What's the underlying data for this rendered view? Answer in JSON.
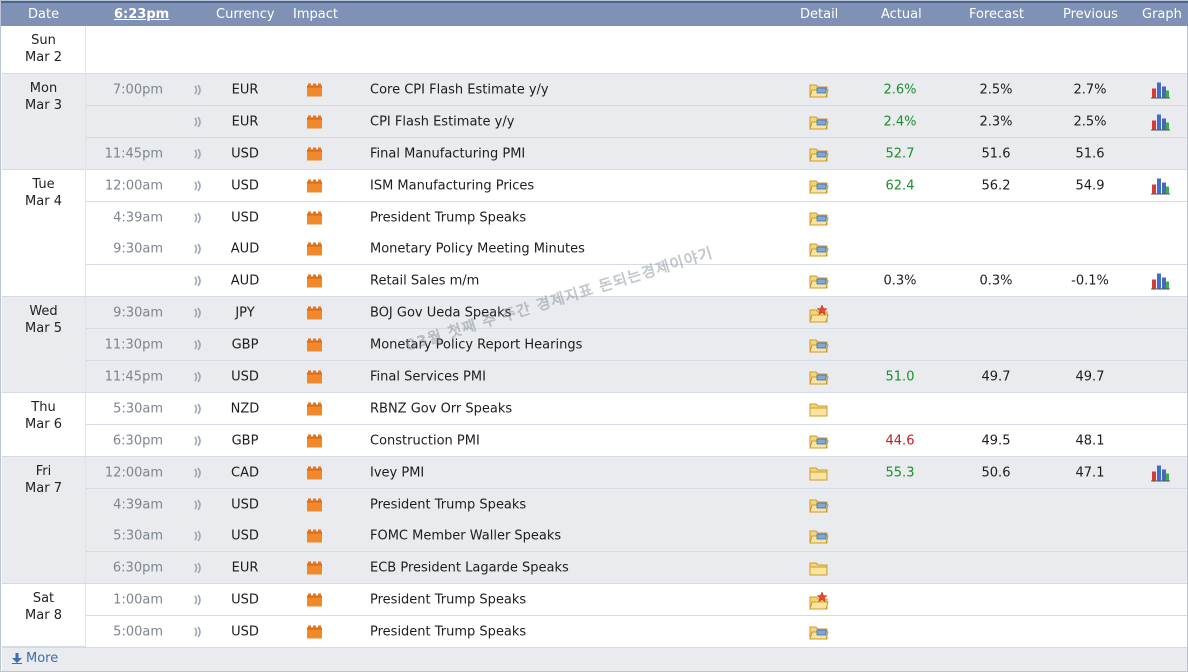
{
  "header": {
    "date": "Date",
    "time": "6:23pm",
    "currency": "Currency",
    "impact": "Impact",
    "detail": "Detail",
    "actual": "Actual",
    "forecast": "Forecast",
    "previous": "Previous",
    "graph": "Graph"
  },
  "days": [
    {
      "dow": "Sun",
      "date": "Mar 2"
    },
    {
      "dow": "Mon",
      "date": "Mar 3"
    },
    {
      "dow": "Tue",
      "date": "Mar 4"
    },
    {
      "dow": "Wed",
      "date": "Mar 5"
    },
    {
      "dow": "Thu",
      "date": "Mar 6"
    },
    {
      "dow": "Fri",
      "date": "Mar 7"
    },
    {
      "dow": "Sat",
      "date": "Mar 8"
    }
  ],
  "events": [
    {
      "time": "7:00pm",
      "currency": "EUR",
      "event": "Core CPI Flash Estimate y/y",
      "actual": "2.6%",
      "actual_status": "good",
      "forecast": "2.5%",
      "previous": "2.7%",
      "detail_icon": "folder-icon",
      "graph": true
    },
    {
      "time": "",
      "currency": "EUR",
      "event": "CPI Flash Estimate y/y",
      "actual": "2.4%",
      "actual_status": "good",
      "forecast": "2.3%",
      "previous": "2.5%",
      "detail_icon": "folder-icon",
      "graph": true
    },
    {
      "time": "11:45pm",
      "currency": "USD",
      "event": "Final Manufacturing PMI",
      "actual": "52.7",
      "actual_status": "good",
      "forecast": "51.6",
      "previous": "51.6",
      "detail_icon": "folder-icon",
      "graph": false
    },
    {
      "time": "12:00am",
      "currency": "USD",
      "event": "ISM Manufacturing Prices",
      "actual": "62.4",
      "actual_status": "good",
      "forecast": "56.2",
      "previous": "54.9",
      "detail_icon": "folder-icon",
      "graph": true
    },
    {
      "time": "4:39am",
      "currency": "USD",
      "event": "President Trump Speaks",
      "actual": "",
      "actual_status": "neutral",
      "forecast": "",
      "previous": "",
      "detail_icon": "folder-icon",
      "graph": false
    },
    {
      "time": "9:30am",
      "currency": "AUD",
      "event": "Monetary Policy Meeting Minutes",
      "actual": "",
      "actual_status": "neutral",
      "forecast": "",
      "previous": "",
      "detail_icon": "folder-icon",
      "graph": false
    },
    {
      "time": "",
      "currency": "AUD",
      "event": "Retail Sales m/m",
      "actual": "0.3%",
      "actual_status": "neutral",
      "forecast": "0.3%",
      "previous": "-0.1%",
      "detail_icon": "folder-icon",
      "graph": true
    },
    {
      "time": "9:30am",
      "currency": "JPY",
      "event": "BOJ Gov Ueda Speaks",
      "actual": "",
      "actual_status": "neutral",
      "forecast": "",
      "previous": "",
      "detail_icon": "folder-star-icon",
      "graph": false
    },
    {
      "time": "11:30pm",
      "currency": "GBP",
      "event": "Monetary Policy Report Hearings",
      "actual": "",
      "actual_status": "neutral",
      "forecast": "",
      "previous": "",
      "detail_icon": "folder-icon",
      "graph": false
    },
    {
      "time": "11:45pm",
      "currency": "USD",
      "event": "Final Services PMI",
      "actual": "51.0",
      "actual_status": "good",
      "forecast": "49.7",
      "previous": "49.7",
      "detail_icon": "folder-icon",
      "graph": false
    },
    {
      "time": "5:30am",
      "currency": "NZD",
      "event": "RBNZ Gov Orr Speaks",
      "actual": "",
      "actual_status": "neutral",
      "forecast": "",
      "previous": "",
      "detail_icon": "folder-closed-icon",
      "graph": false
    },
    {
      "time": "6:30pm",
      "currency": "GBP",
      "event": "Construction PMI",
      "actual": "44.6",
      "actual_status": "bad",
      "forecast": "49.5",
      "previous": "48.1",
      "detail_icon": "folder-icon",
      "graph": false
    },
    {
      "time": "12:00am",
      "currency": "CAD",
      "event": "Ivey PMI",
      "actual": "55.3",
      "actual_status": "good",
      "forecast": "50.6",
      "previous": "47.1",
      "detail_icon": "folder-closed-icon",
      "graph": true
    },
    {
      "time": "4:39am",
      "currency": "USD",
      "event": "President Trump Speaks",
      "actual": "",
      "actual_status": "neutral",
      "forecast": "",
      "previous": "",
      "detail_icon": "folder-icon",
      "graph": false
    },
    {
      "time": "5:30am",
      "currency": "USD",
      "event": "FOMC Member Waller Speaks",
      "actual": "",
      "actual_status": "neutral",
      "forecast": "",
      "previous": "",
      "detail_icon": "folder-icon",
      "graph": false
    },
    {
      "time": "6:30pm",
      "currency": "EUR",
      "event": "ECB President Lagarde Speaks",
      "actual": "",
      "actual_status": "neutral",
      "forecast": "",
      "previous": "",
      "detail_icon": "folder-closed-icon",
      "graph": false
    },
    {
      "time": "1:00am",
      "currency": "USD",
      "event": "President Trump Speaks",
      "actual": "",
      "actual_status": "neutral",
      "forecast": "",
      "previous": "",
      "detail_icon": "folder-star-icon",
      "graph": false
    },
    {
      "time": "5:00am",
      "currency": "USD",
      "event": "President Trump Speaks",
      "actual": "",
      "actual_status": "neutral",
      "forecast": "",
      "previous": "",
      "detail_icon": "folder-icon",
      "graph": false
    }
  ],
  "footer": {
    "more": "More"
  },
  "watermark": "03월 첫째 주 주간 경제지표 돈되는경제이야기",
  "colors": {
    "header_bg": "#7f91b4",
    "good": "#1c8f2b",
    "bad": "#c0181e",
    "impact_high": "#f0892a",
    "row_shade": "#e9ebef"
  }
}
